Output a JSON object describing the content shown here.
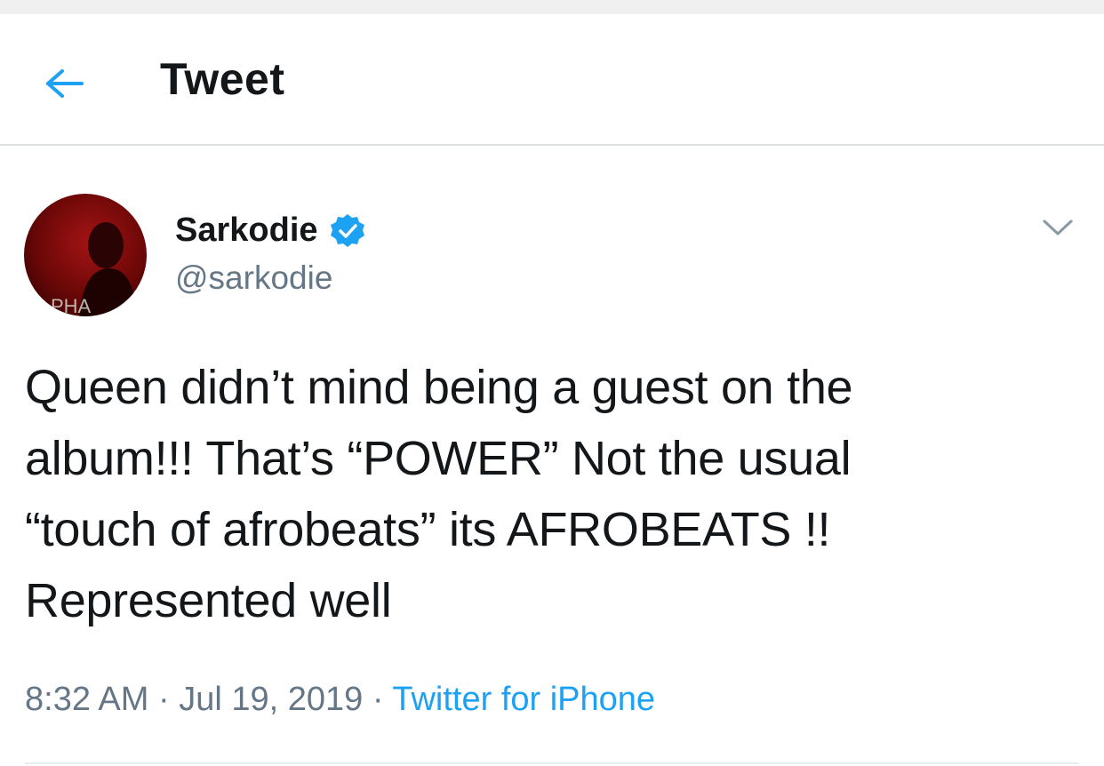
{
  "header": {
    "title": "Tweet",
    "back_icon": "arrow-left-icon"
  },
  "tweet": {
    "author": {
      "name": "Sarkodie",
      "handle": "@sarkodie",
      "verified": true,
      "avatar_text": "PHA"
    },
    "text": "Queen didn’t mind being a guest on the\nalbum!!! That’s “POWER” Not the usual\n“touch of afrobeats” its AFROBEATS !!\nRepresented well",
    "time": "8:32 AM",
    "date": "Jul 19, 2019",
    "separator": "·",
    "source": "Twitter for iPhone",
    "menu_icon": "chevron-down-icon"
  },
  "colors": {
    "accent": "#1da1f2",
    "text_primary": "#14171a",
    "text_secondary": "#657786",
    "divider": "#dcdfe2",
    "avatar_bg": "#7a0a0a"
  }
}
